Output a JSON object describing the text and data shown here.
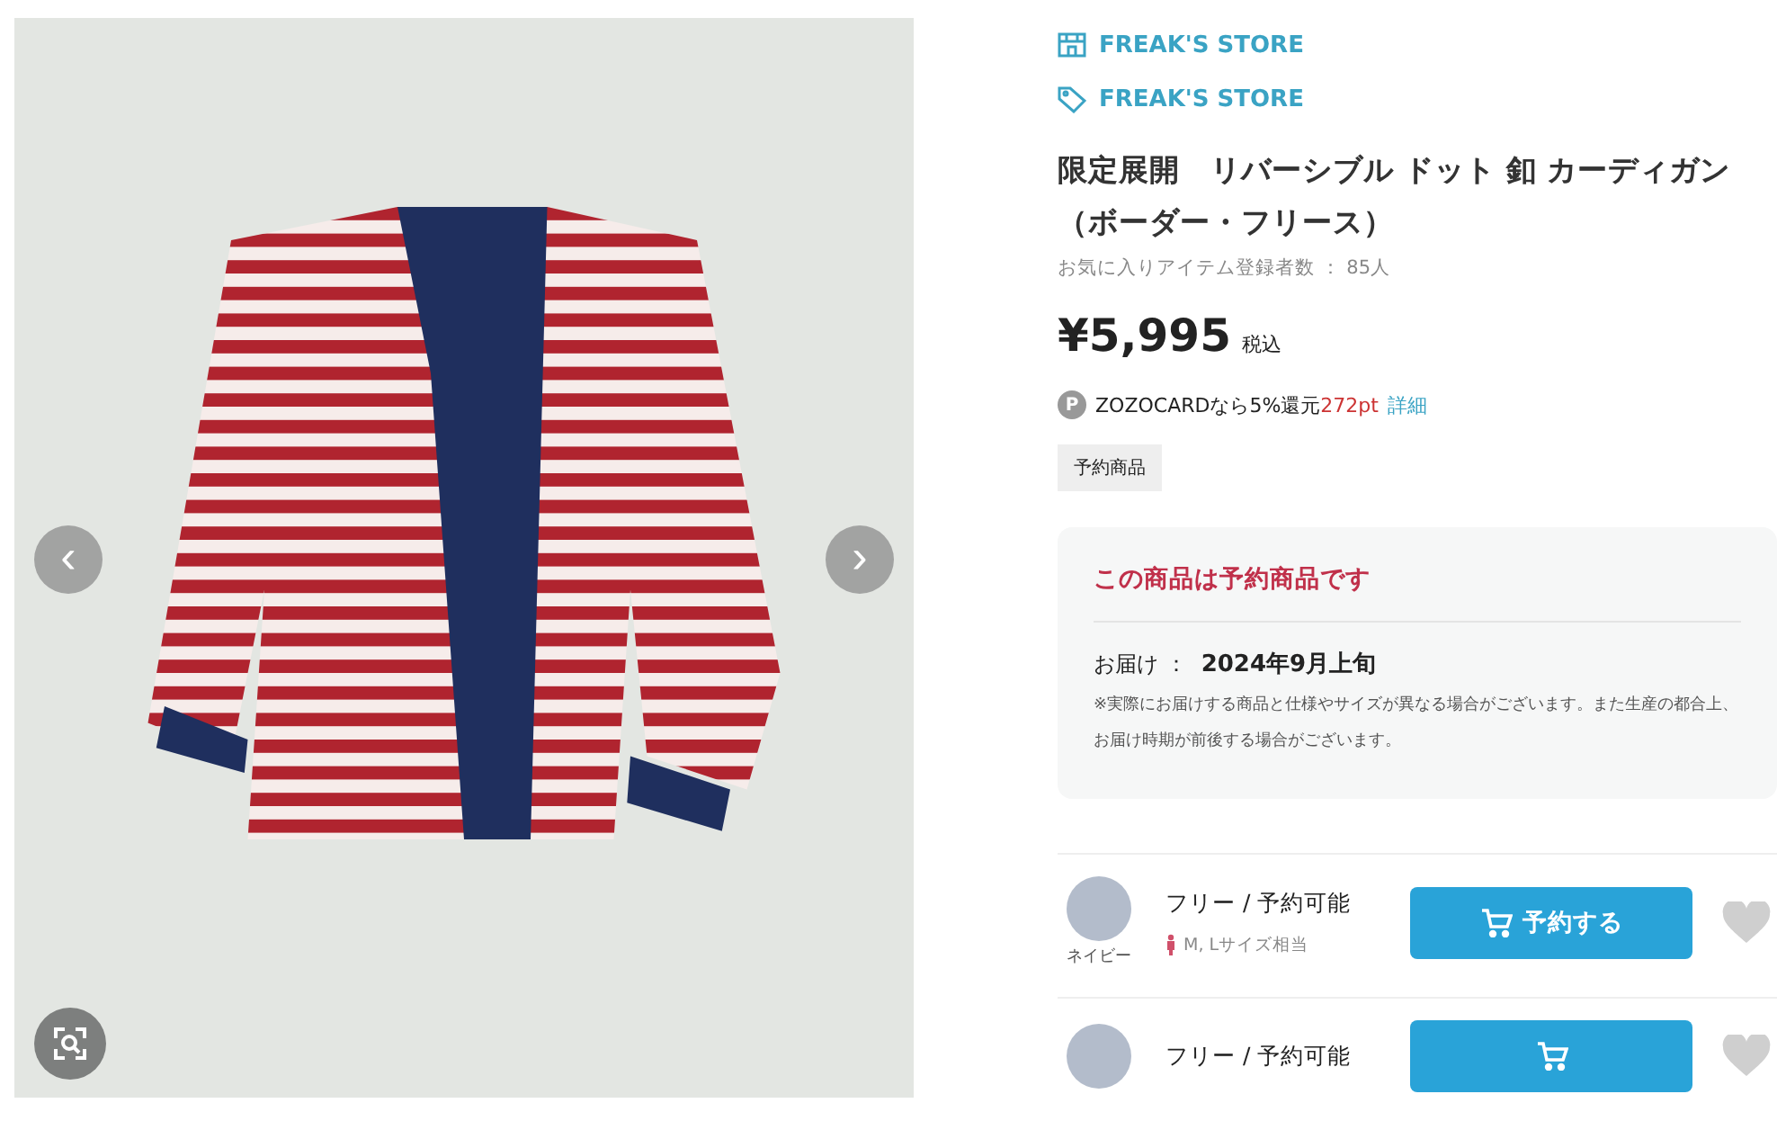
{
  "gallery": {
    "prev_button": "‹",
    "next_button": "›"
  },
  "brand_links": [
    {
      "kind": "shop",
      "label": "FREAK'S STORE"
    },
    {
      "kind": "brand",
      "label": "FREAK'S STORE"
    }
  ],
  "title": "限定展開　リバーシブル ドット 釦 カーディガン（ボーダー・フリース）",
  "favorites": "お気に入りアイテム登録者数 ： 85人",
  "price": {
    "amount": "¥5,995",
    "tax": "税込"
  },
  "points": {
    "badge": "P",
    "text": "ZOZOCARDなら5%還元",
    "amount": "272pt",
    "link": "詳細"
  },
  "tag": "予約商品",
  "preorder": {
    "heading": "この商品は予約商品です",
    "delivery_label": "お届け ：",
    "delivery_date": "2024年9月上旬",
    "note": "※実際にお届けする商品と仕様やサイズが異なる場合がございます。また生産の都合上、お届け時期が前後する場合がございます。"
  },
  "variants": [
    {
      "color_name": "ネイビー",
      "size_status": "フリー / 予約可能",
      "fit_note": "M, Lサイズ相当",
      "button": "予約する"
    },
    {
      "size_status": "フリー / 予約可能"
    }
  ]
}
